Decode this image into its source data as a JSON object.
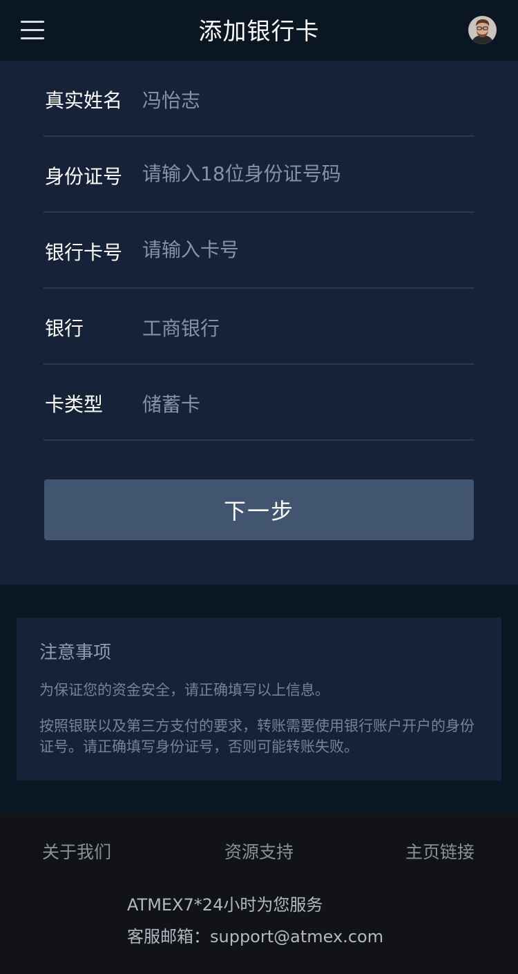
{
  "header": {
    "title": "添加银行卡",
    "menu_icon": "hamburger-menu-icon",
    "avatar_icon": "user-avatar"
  },
  "form": {
    "fields": [
      {
        "label": "真实姓名",
        "value": "冯怡志"
      },
      {
        "label": "身份证号",
        "placeholder": "请输入18位身份证号码",
        "value": ""
      },
      {
        "label": "银行卡号",
        "placeholder": "请输入卡号",
        "value": ""
      },
      {
        "label": "银行",
        "value": "工商银行"
      },
      {
        "label": "卡类型",
        "value": "储蓄卡"
      }
    ],
    "submit_label": "下一步"
  },
  "notice": {
    "title": "注意事项",
    "lines": [
      "为保证您的资金安全，请正确填写以上信息。",
      "按照银联以及第三方支付的要求，转账需要使用银行账户开户的身份证号。请正确填写身份证号，否则可能转账失败。"
    ]
  },
  "footer": {
    "links": [
      "关于我们",
      "资源支持",
      "主页链接"
    ],
    "service_text": "ATMEX7*24小时为您服务",
    "email_text": "客服邮箱：support@atmex.com"
  },
  "colors": {
    "header_bg": "#0b1623",
    "card_bg": "#162237",
    "button_bg": "#425570",
    "footer_bg": "#111317",
    "muted_text": "#8593a8"
  }
}
